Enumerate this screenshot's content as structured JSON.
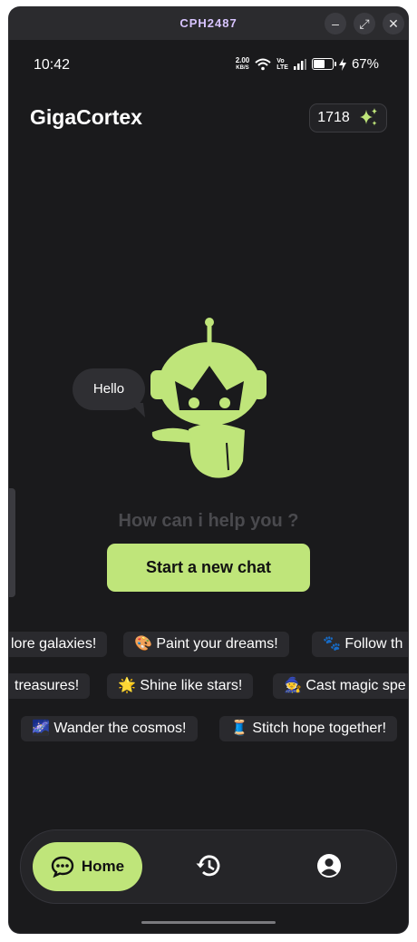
{
  "window": {
    "title": "CPH2487"
  },
  "status": {
    "time": "10:42",
    "net_speed_value": "2.00",
    "net_speed_unit": "KB/S",
    "battery": "67%",
    "battery_level": 0.67
  },
  "app": {
    "title": "GigaCortex",
    "credits": "1718"
  },
  "mascot": {
    "greeting": "Hello"
  },
  "prompt": {
    "help_text": "How can i help you ?",
    "start_label": "Start a new chat"
  },
  "suggestions": {
    "row1": [
      "lore galaxies!",
      "🎨 Paint your dreams!",
      "🐾 Follow th"
    ],
    "row2": [
      "treasures!",
      "🌟 Shine like stars!",
      "🧙 Cast magic spe"
    ],
    "row3": [
      "🌌 Wander the cosmos!",
      "🧵 Stitch hope together!"
    ]
  },
  "nav": {
    "home_label": "Home"
  },
  "colors": {
    "accent": "#bfe57a",
    "background": "#1a1a1c"
  }
}
